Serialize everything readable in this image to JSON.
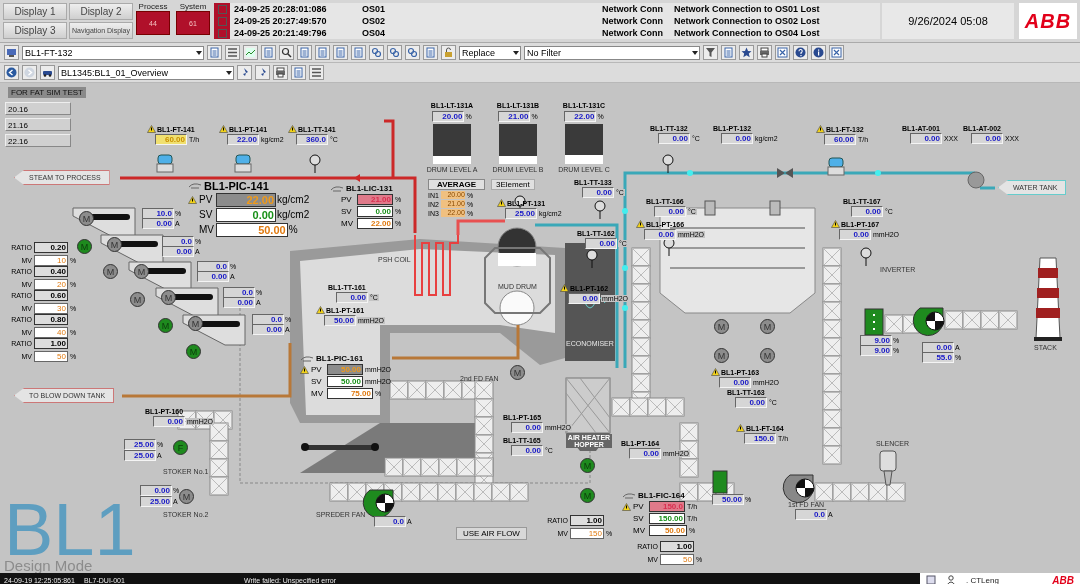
{
  "header": {
    "nav_buttons": [
      "Display 1",
      "Display 2",
      "Display 3",
      "Navigation Display"
    ],
    "indicators": [
      {
        "label": "Process",
        "count": "44"
      },
      {
        "label": "System",
        "count": "61"
      }
    ],
    "alarms": [
      {
        "acknowledged": false,
        "time": "24-09-25 20:28:01:086",
        "node": "OS01",
        "category": "Network Conn",
        "message": "Network Connection to OS01 Lost"
      },
      {
        "acknowledged": false,
        "time": "24-09-25 20:27:49:570",
        "node": "OS02",
        "category": "Network Conn",
        "message": "Network Connection to OS02 Lost"
      },
      {
        "acknowledged": false,
        "time": "24-09-25 20:21:49:796",
        "node": "OS04",
        "category": "Network Conn",
        "message": "Network Connection to OS04 Lost"
      }
    ],
    "datetime": "9/26/2024 05:08",
    "logo": "ABB"
  },
  "toolbar": {
    "object": "BL1-FT-132",
    "mode": "Replace",
    "filter": "No Filter"
  },
  "navbar": {
    "display": "BL1345:BL1_01_Overview"
  },
  "canvas": {
    "title": "FOR FAT SIM TEST",
    "side_values": [
      "20.16",
      "21.16",
      "22.16"
    ],
    "measurements": [
      {
        "tag": "BL1-FT-141",
        "alarm": true,
        "value": "60.00",
        "unit": "T/h",
        "highlight": true
      },
      {
        "tag": "BL1-PT-141",
        "alarm": true,
        "value": "22.00",
        "unit": "kg/cm2",
        "highlight": false
      },
      {
        "tag": "BL1-TT-141",
        "alarm": true,
        "value": "360.0",
        "unit": "°C",
        "highlight": false
      },
      {
        "tag": "BL1-TT-132",
        "alarm": false,
        "value": "0.00",
        "unit": "°C",
        "highlight": false
      },
      {
        "tag": "BL1-PT-132",
        "alarm": false,
        "value": "0.00",
        "unit": "kg/cm2",
        "highlight": false
      },
      {
        "tag": "BL1-FT-132",
        "alarm": true,
        "value": "60.00",
        "unit": "T/h",
        "highlight": false
      },
      {
        "tag": "BL1-AT-001",
        "alarm": false,
        "value": "0.00",
        "unit": "XXX",
        "highlight": false
      },
      {
        "tag": "BL1-AT-002",
        "alarm": false,
        "value": "0.00",
        "unit": "XXX",
        "highlight": false
      },
      {
        "tag": "BL1-TT-133",
        "alarm": false,
        "value": "0.00",
        "unit": "°C",
        "highlight": false
      },
      {
        "tag": "BL1-PT-131",
        "alarm": true,
        "value": "25.00",
        "unit": "kg/cm2",
        "highlight": false
      },
      {
        "tag": "BL1-TT-166",
        "alarm": false,
        "value": "0.00",
        "unit": "°C",
        "highlight": false
      },
      {
        "tag": "BL1-TT-167",
        "alarm": false,
        "value": "0.00",
        "unit": "°C",
        "highlight": false
      },
      {
        "tag": "BL1-PT-166",
        "alarm": true,
        "value": "0.00",
        "unit": "mmH2O",
        "highlight": false
      },
      {
        "tag": "BL1-PT-167",
        "alarm": true,
        "value": "0.00",
        "unit": "mmH2O",
        "highlight": false
      },
      {
        "tag": "BL1-TT-162",
        "alarm": false,
        "value": "0.00",
        "unit": "°C",
        "highlight": false
      },
      {
        "tag": "BL1-TT-161",
        "alarm": false,
        "value": "0.00",
        "unit": "°C",
        "highlight": false
      },
      {
        "tag": "BL1-PT-162",
        "alarm": true,
        "value": "0.00",
        "unit": "mmH2O",
        "highlight": false
      },
      {
        "tag": "BL1-PT-161",
        "alarm": true,
        "value": "50.00",
        "unit": "mmH2O",
        "highlight": false
      },
      {
        "tag": "BL1-PT-163",
        "alarm": true,
        "value": "0.00",
        "unit": "mmH2O",
        "highlight": false
      },
      {
        "tag": "BL1-TT-163",
        "alarm": false,
        "value": "0.00",
        "unit": "°C",
        "highlight": false
      },
      {
        "tag": "BL1-PT-160",
        "alarm": false,
        "value": "0.00",
        "unit": "mmH2O",
        "highlight": false
      },
      {
        "tag": "BL1-PT-165",
        "alarm": false,
        "value": "0.00",
        "unit": "mmH2O",
        "highlight": false
      },
      {
        "tag": "BL1-FT-164",
        "alarm": true,
        "value": "150.0",
        "unit": "T/h",
        "highlight": false
      },
      {
        "tag": "BL1-TT-165",
        "alarm": false,
        "value": "0.00",
        "unit": "°C",
        "highlight": false
      },
      {
        "tag": "BL1-PT-164",
        "alarm": false,
        "value": "0.00",
        "unit": "mmH2O",
        "highlight": false
      }
    ],
    "controllers": [
      {
        "tag": "BL1-PIC-141",
        "rows": [
          {
            "label": "PV",
            "kind": "pv_uncertain",
            "alarm": true,
            "value": "22.00",
            "unit": "kg/cm2"
          },
          {
            "label": "SV",
            "kind": "sv",
            "alarm": false,
            "value": "0.00",
            "unit": "kg/cm2"
          },
          {
            "label": "MV",
            "kind": "mv",
            "alarm": false,
            "value": "50.00",
            "unit": "%"
          }
        ]
      },
      {
        "tag": "BL1-LIC-131",
        "rows": [
          {
            "label": "PV",
            "kind": "pv_alarm",
            "alarm": false,
            "value": "21.00",
            "unit": "%"
          },
          {
            "label": "SV",
            "kind": "sv",
            "alarm": false,
            "value": "0.00",
            "unit": "%"
          },
          {
            "label": "MV",
            "kind": "mv",
            "alarm": false,
            "value": "22.00",
            "unit": "%"
          }
        ]
      },
      {
        "tag": "BL1-PIC-161",
        "rows": [
          {
            "label": "PV",
            "kind": "pv_uncertain",
            "alarm": true,
            "value": "50.00",
            "unit": "mmH2O"
          },
          {
            "label": "SV",
            "kind": "sv",
            "alarm": false,
            "value": "50.00",
            "unit": "mmH2O"
          },
          {
            "label": "MV",
            "kind": "mv",
            "alarm": false,
            "value": "75.00",
            "unit": "%"
          }
        ]
      },
      {
        "tag": "BL1-FIC-164",
        "rows": [
          {
            "label": "PV",
            "kind": "pv_alarm",
            "alarm": true,
            "value": "150.0",
            "unit": "T/h"
          },
          {
            "label": "SV",
            "kind": "sv",
            "alarm": false,
            "value": "150.00",
            "unit": "T/h"
          },
          {
            "label": "MV",
            "kind": "mv",
            "alarm": false,
            "value": "50.00",
            "unit": "%"
          }
        ]
      }
    ],
    "ratio_stations": [
      {
        "ratio_label": "RATIO",
        "ratio": "0.20",
        "mv_label": "MV",
        "mv": "10",
        "unit": "%"
      },
      {
        "ratio_label": "RATIO",
        "ratio": "0.40",
        "mv_label": "MV",
        "mv": "20",
        "unit": "%"
      },
      {
        "ratio_label": "RATIO",
        "ratio": "0.60",
        "mv_label": "MV",
        "mv": "30",
        "unit": "%"
      },
      {
        "ratio_label": "RATIO",
        "ratio": "0.80",
        "mv_label": "MV",
        "mv": "40",
        "unit": "%"
      },
      {
        "ratio_label": "RATIO",
        "ratio": "1.00",
        "mv_label": "MV",
        "mv": "50",
        "unit": "%"
      },
      {
        "ratio_label": "RATIO",
        "ratio": "1.00",
        "mv_label": "MV",
        "mv": "150",
        "unit": "%"
      },
      {
        "ratio_label": "RATIO",
        "ratio": "1.00",
        "mv_label": "MV",
        "mv": "50",
        "unit": "%"
      }
    ],
    "readouts": [
      {
        "value": "10.0",
        "unit": "%"
      },
      {
        "value": "0.00",
        "unit": "A"
      },
      {
        "value": "0.0",
        "unit": "%"
      },
      {
        "value": "0.00",
        "unit": "A"
      },
      {
        "value": "0.0",
        "unit": "%"
      },
      {
        "value": "0.00",
        "unit": "A"
      },
      {
        "value": "0.0",
        "unit": "%"
      },
      {
        "value": "0.00",
        "unit": "A"
      },
      {
        "value": "0.0",
        "unit": "%"
      },
      {
        "value": "0.00",
        "unit": "A"
      },
      {
        "value": "25.00",
        "unit": "%"
      },
      {
        "value": "25.00",
        "unit": "A"
      },
      {
        "value": "0.00",
        "unit": "%"
      },
      {
        "value": "25.00",
        "unit": "A"
      },
      {
        "value": "0.0",
        "unit": "A"
      },
      {
        "value": "0.0",
        "unit": "A"
      },
      {
        "value": "50.00",
        "unit": "%"
      },
      {
        "value": "9.00",
        "unit": "%"
      },
      {
        "value": "9.00",
        "unit": "%"
      },
      {
        "value": "0.00",
        "unit": "A"
      },
      {
        "value": "55.0",
        "unit": "%"
      }
    ],
    "drum_levels": [
      {
        "tag": "BL1-LT-131A",
        "value": "20.00",
        "unit": "%",
        "level": 0.2,
        "label": "DRUM LEVEL A"
      },
      {
        "tag": "BL1-LT-131B",
        "value": "21.00",
        "unit": "%",
        "level": 0.21,
        "label": "DRUM LEVEL B"
      },
      {
        "tag": "BL1-LT-131C",
        "value": "22.00",
        "unit": "%",
        "level": 0.22,
        "label": "DRUM LEVEL C"
      }
    ],
    "level_select": {
      "average": "AVERAGE",
      "mode": "3Element",
      "inputs": [
        {
          "label": "IN1",
          "value": "20.00",
          "unit": "%"
        },
        {
          "label": "IN2",
          "value": "21.00",
          "unit": "%"
        },
        {
          "label": "IN3",
          "value": "22.00",
          "unit": "%"
        }
      ]
    },
    "labels": [
      {
        "kind": "arrow",
        "text": "STEAM TO PROCESS"
      },
      {
        "kind": "arrow",
        "text": "WATER TANK"
      },
      {
        "kind": "arrow",
        "text": "TO BLOW DOWN TANK"
      },
      {
        "kind": "plain",
        "text": "PSH COIL"
      },
      {
        "kind": "plain",
        "text": "MUD DRUM"
      },
      {
        "kind": "plain",
        "text": "ECONOMISER"
      },
      {
        "kind": "plain",
        "text": "AIR HEATER HOPPER"
      },
      {
        "kind": "plain",
        "text": "2nd FD FAN"
      },
      {
        "kind": "plain",
        "text": "STOKER No.1"
      },
      {
        "kind": "plain",
        "text": "STOKER No.2"
      },
      {
        "kind": "plain",
        "text": "SPREDER FAN"
      },
      {
        "kind": "button",
        "text": "USE AIR FLOW"
      },
      {
        "kind": "plain",
        "text": "INVERTER"
      },
      {
        "kind": "plain",
        "text": "STACK"
      },
      {
        "kind": "plain",
        "text": "SLENCER"
      },
      {
        "kind": "plain",
        "text": "1st FD FAN"
      }
    ],
    "motors": [
      {
        "label": "M",
        "running": false
      },
      {
        "label": "M",
        "running": false
      },
      {
        "label": "M",
        "running": false
      },
      {
        "label": "M",
        "running": false
      },
      {
        "label": "M",
        "running": false
      },
      {
        "label": "M",
        "running": true
      },
      {
        "label": "M",
        "running": false
      },
      {
        "label": "M",
        "running": false
      },
      {
        "label": "M",
        "running": true
      },
      {
        "label": "M",
        "running": true
      },
      {
        "label": "F",
        "running": true
      },
      {
        "label": "M",
        "running": false
      },
      {
        "label": "M",
        "running": false
      },
      {
        "label": "M",
        "running": false
      },
      {
        "label": "M",
        "running": false
      },
      {
        "label": "M",
        "running": false
      },
      {
        "label": "M",
        "running": false
      },
      {
        "label": "M",
        "running": true
      },
      {
        "label": "M",
        "running": true
      }
    ],
    "fans": [
      {
        "running": true
      },
      {
        "running": true
      },
      {
        "running": false
      }
    ],
    "mode_mark": {
      "area": "BL1",
      "mode": "Design Mode"
    }
  },
  "status_bar": {
    "time": "24-09-19 12:25:05:861",
    "node": "BL7-DUI-001",
    "message": "Write failed: Unspecified error",
    "user": ". CTLeng",
    "logo": "ABB"
  }
}
